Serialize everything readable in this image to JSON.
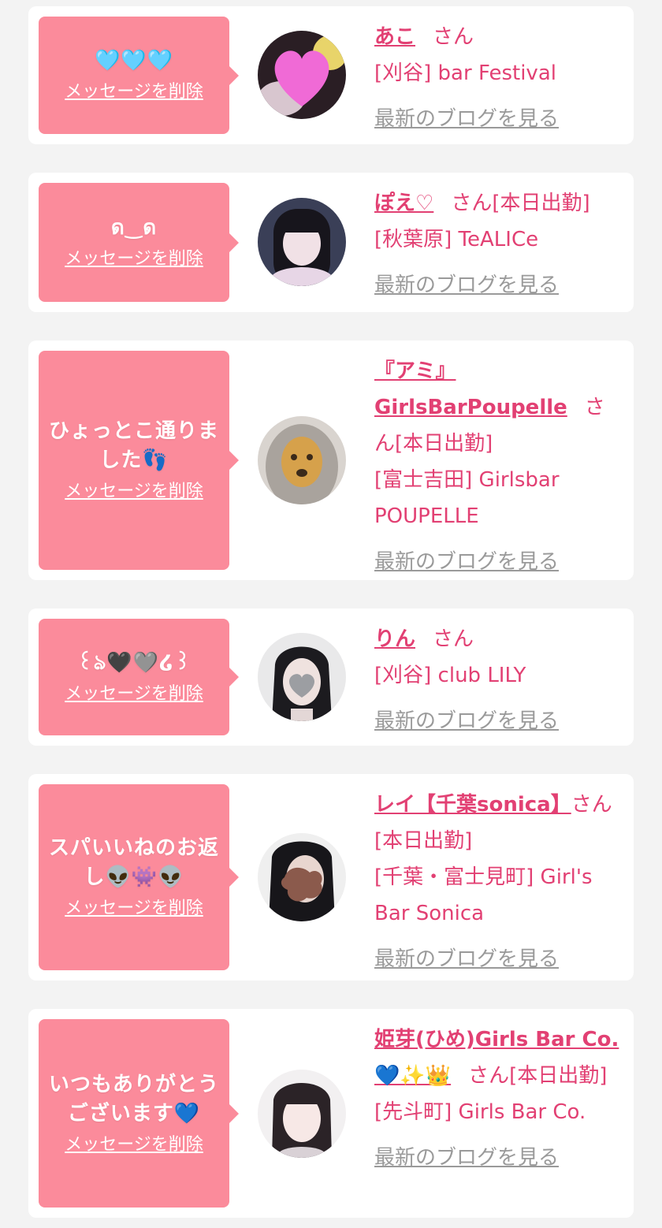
{
  "colors": {
    "page_bg": "#f3f3f3",
    "bubble": "#fb8b9b",
    "accent": "#e24073",
    "link_gray": "#9a9a9a"
  },
  "cards": [
    {
      "message": "🩵🩵🩵",
      "delete_label": "メッセージを削除",
      "name": "あこ",
      "san": "さん",
      "status": "",
      "shop": "[刈谷] bar Festival",
      "blog_label": "最新のブログを見る"
    },
    {
      "message": "ด‿ด",
      "delete_label": "メッセージを削除",
      "name": "ぽえ♡",
      "san": "さん",
      "status": "[本日出勤]",
      "shop": "[秋葉原] TeALICe",
      "blog_label": "最新のブログを見る"
    },
    {
      "message": "ひょっとこ通りました👣",
      "delete_label": "メッセージを削除",
      "name": "『アミ』GirlsBarPoupelle",
      "san": "さん",
      "status": "[本日出勤]",
      "shop": "[富士吉田] Girlsbar POUPELLE",
      "blog_label": "最新のブログを見る"
    },
    {
      "message": "꒰ঌ🖤🩶໒꒱",
      "delete_label": "メッセージを削除",
      "name": "りん",
      "san": "さん",
      "status": "",
      "shop": "[刈谷] club LILY",
      "blog_label": "最新のブログを見る"
    },
    {
      "message": "スパいいねのお返し👽👾👽",
      "delete_label": "メッセージを削除",
      "name": "レイ【千葉sonica】",
      "san": "さん",
      "status": "[本日出勤]",
      "shop": "[千葉・富士見町] Girl's Bar Sonica",
      "blog_label": "最新のブログを見る"
    },
    {
      "message": "いつもありがとうございます💙",
      "delete_label": "メッセージを削除",
      "name": "姫芽(ひめ)Girls Bar Co.💙✨👑",
      "san": "さん",
      "status": "[本日出勤]",
      "shop": "[先斗町] Girls Bar Co.",
      "blog_label": "最新のブログを見る"
    }
  ]
}
